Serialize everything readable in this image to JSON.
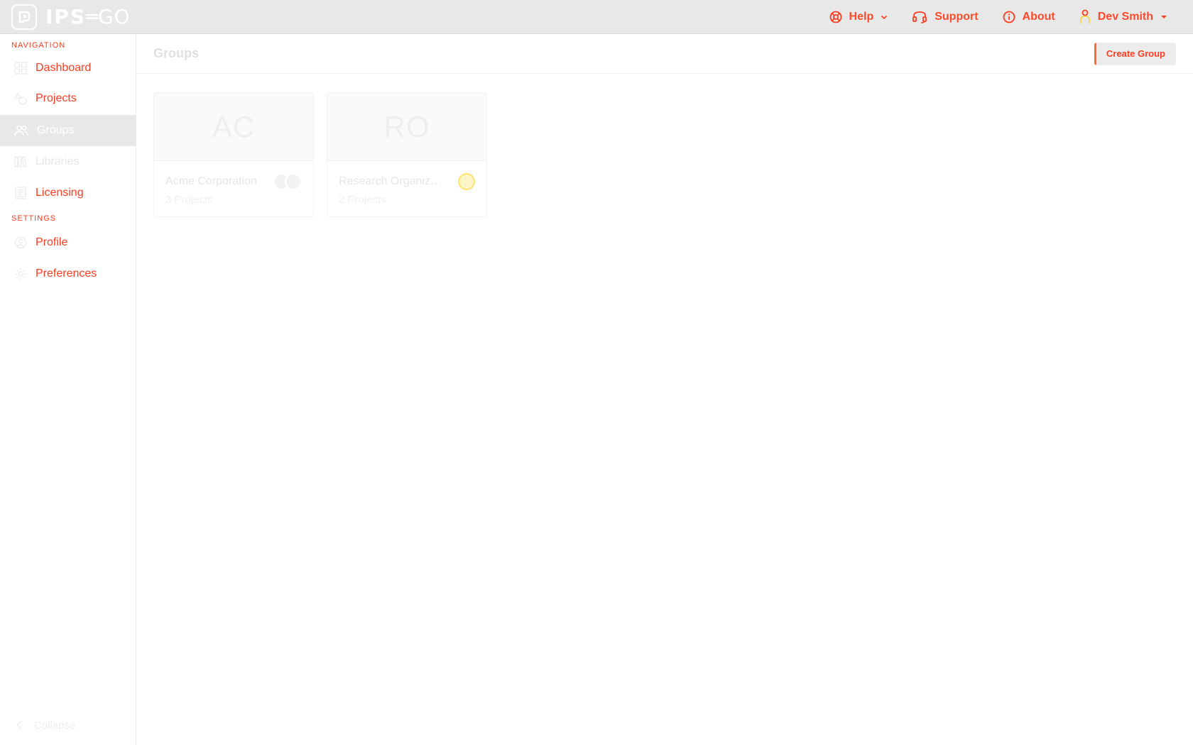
{
  "topbar": {
    "logo_text": "IPS",
    "logo_suffix": "GO",
    "help_label": "Help",
    "support_label": "Support",
    "about_label": "About",
    "user_label": "Dev Smith"
  },
  "sidebar": {
    "navigation_label": "Navigation",
    "nav_items": [
      {
        "label": "Dashboard"
      },
      {
        "label": "Projects"
      },
      {
        "label": "Groups"
      },
      {
        "label": "Libraries"
      },
      {
        "label": "Licensing"
      }
    ],
    "settings_label": "Settings",
    "settings_items": [
      {
        "label": "Profile"
      },
      {
        "label": "Preferences"
      }
    ],
    "collapse_label": "Collapse"
  },
  "main": {
    "title": "Groups",
    "create_button": "Create Group",
    "groups": [
      {
        "initials": "AC",
        "name": "Acme Corporation",
        "projects": "3 Projects"
      },
      {
        "initials": "RO",
        "name": "Research Organiza...",
        "projects": "2 Projects"
      }
    ]
  },
  "colors": {
    "accent": "#ff3b1f",
    "topbar_bg": "#e8e8e8",
    "active_nav_bg": "#e8e8e8"
  }
}
